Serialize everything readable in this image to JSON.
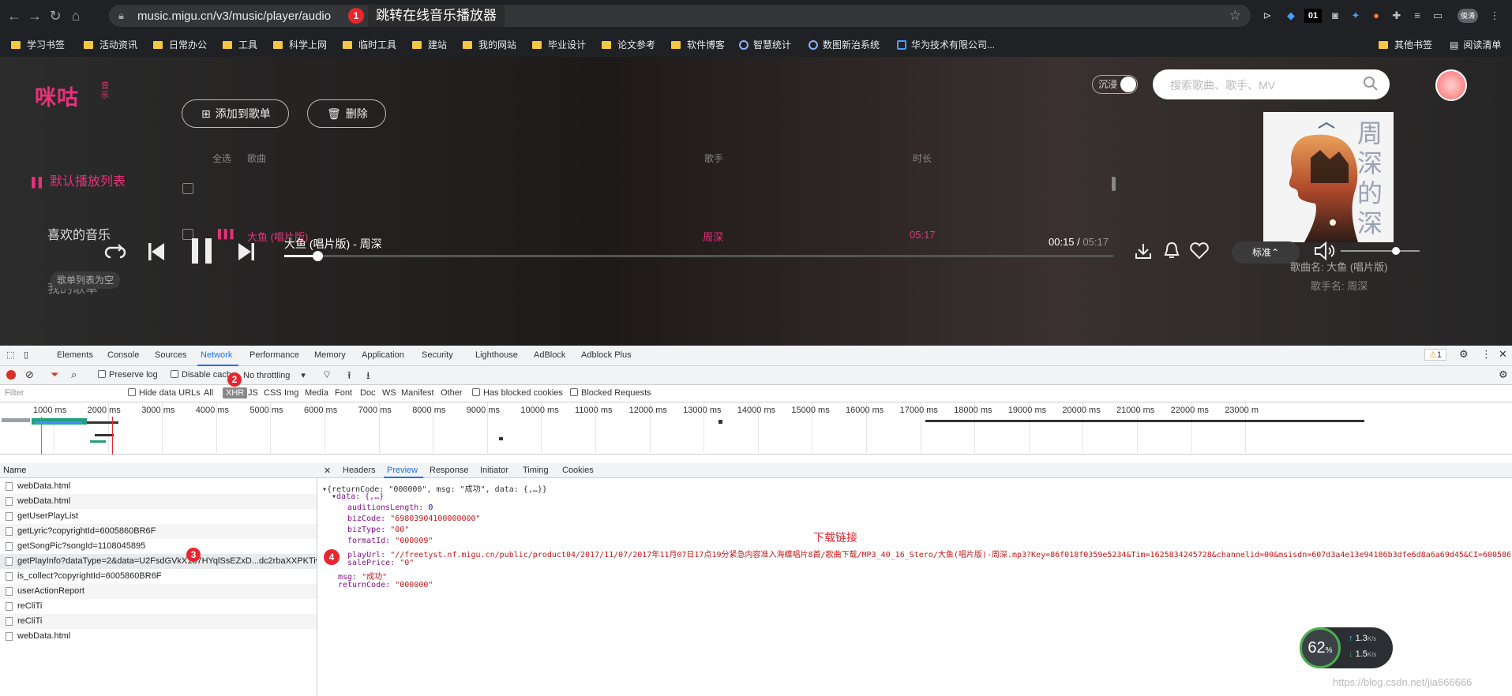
{
  "browser": {
    "url": "music.migu.cn/v3/music/player/audio",
    "annotation_jump": "跳转在线音乐播放器",
    "badges": [
      "1",
      "2",
      "3",
      "4"
    ],
    "ext_labels": {
      "num": "01",
      "profile": "俊涛"
    },
    "bookmarks": [
      "学习书签",
      "活动资讯",
      "日常办公",
      "工具",
      "科学上网",
      "临时工具",
      "建站",
      "我的网站",
      "毕业设计",
      "论文参考",
      "软件博客"
    ],
    "bookmarks_globe": [
      "智慧统计",
      "数图新治系统",
      "华为技术有限公司..."
    ],
    "bookmarks_right": [
      "其他书签",
      "阅读清单"
    ]
  },
  "player": {
    "logo": "咪咕",
    "logo_sub": "音乐",
    "immersive": "沉浸",
    "search_placeholder": "搜索歌曲、歌手、MV",
    "add_to_list": "添加到歌单",
    "delete": "删除",
    "sidebar": [
      "默认播放列表",
      "喜欢的音乐",
      "我的歌单"
    ],
    "headers": {
      "select_all": "全选",
      "song": "歌曲",
      "singer": "歌手",
      "duration": "时长"
    },
    "row": {
      "song": "大鱼 (唱片版)",
      "singer": "周深",
      "duration": "05:17"
    },
    "album_title": "周深的深",
    "track_title": "大鱼 (唱片版) - 周深",
    "time_current": "00:15",
    "time_sep": " / ",
    "time_total": "05:17",
    "progress": 0.04,
    "volume": 0.7,
    "quality": "标准",
    "song_name": "歌曲名: 大鱼 (唱片版)",
    "singer_name": "歌手名: 周深",
    "empty_list": "歌单列表为空"
  },
  "devtools": {
    "tabs": [
      "Elements",
      "Console",
      "Sources",
      "Network",
      "Performance",
      "Memory",
      "Application",
      "Security",
      "Lighthouse",
      "AdBlock",
      "Adblock Plus"
    ],
    "warn_count": "1",
    "toolbar": {
      "preserve_log": "Preserve log",
      "disable_cache": "Disable cache",
      "throttling": "No throttling"
    },
    "filter": {
      "placeholder": "Filter",
      "hide_data_urls": "Hide data URLs",
      "types": [
        "All",
        "XHR",
        "JS",
        "CSS",
        "Img",
        "Media",
        "Font",
        "Doc",
        "WS",
        "Manifest",
        "Other"
      ],
      "has_blocked": "Has blocked cookies",
      "blocked_req": "Blocked Requests"
    },
    "timeline_labels": [
      "1000 ms",
      "2000 ms",
      "3000 ms",
      "4000 ms",
      "5000 ms",
      "6000 ms",
      "7000 ms",
      "8000 ms",
      "9000 ms",
      "10000 ms",
      "11000 ms",
      "12000 ms",
      "13000 ms",
      "14000 ms",
      "15000 ms",
      "16000 ms",
      "17000 ms",
      "18000 ms",
      "19000 ms",
      "20000 ms",
      "21000 ms",
      "22000 ms",
      "23000 m"
    ],
    "name_header": "Name",
    "requests": [
      "webData.html",
      "webData.html",
      "getUserPlayList",
      "getLyric?copyrightId=6005860BR6F",
      "getSongPic?songId=1108045895",
      "getPlayInfo?dataType=2&data=U2FsdGVkX187HYqlSsEZxD...dc2rbaXXPKTivY...",
      "is_collect?copyrightId=6005860BR6F",
      "userActionReport",
      "reCliTi",
      "reCliTi",
      "webData.html"
    ],
    "preview_tabs": [
      "Headers",
      "Preview",
      "Response",
      "Initiator",
      "Timing",
      "Cookies"
    ],
    "json": {
      "root": "{returnCode: \"000000\", msg: \"成功\", data: {,…}}",
      "data": "data: {,…}",
      "auditionsLength": "0",
      "bizCode": "\"69803904100000000\"",
      "bizType": "\"00\"",
      "formatId": "\"000009\"",
      "playUrl": "\"//freetyst.nf.migu.cn/public/product04/2017/11/07/2017年11月07日17点19分紧急内容准入海蝶唱片8首/歌曲下载/MP3_40_16_Stero/大鱼(唱片版)-周深.mp3?Key=86f018f0359e5234&Tim=1625834245728&channelid=00&msisdn=607d3a4e13e94186b3dfe6d8a6a69d45&CI=600586",
      "salePrice": "\"0\"",
      "msg": "\"成功\"",
      "returnCode": "\"000000\""
    },
    "download_annotation": "下载链接"
  },
  "netmon": {
    "percent": "62",
    "unit": "%",
    "up": "1.3",
    "down": "1.5",
    "speed_unit": "K/s"
  },
  "watermark": "https://blog.csdn.net/jia666666"
}
